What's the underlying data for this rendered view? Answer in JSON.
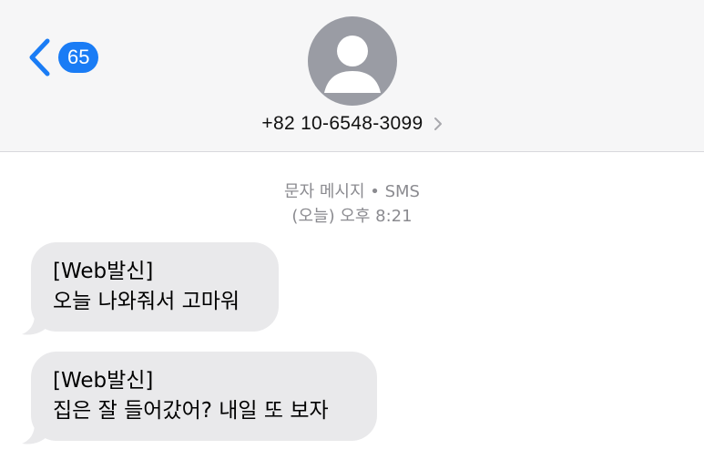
{
  "header": {
    "back_badge": "65",
    "contact_number": "+82 10-6548-3099"
  },
  "meta": {
    "channel": "문자 메시지 • SMS",
    "timestamp": "(오늘) 오후 8:21"
  },
  "messages": [
    {
      "line1": "[Web발신]",
      "line2": "오늘 나와줘서 고마워"
    },
    {
      "line1": "[Web발신]",
      "line2": "집은 잘 들어갔어? 내일 또 보자"
    }
  ],
  "colors": {
    "accent": "#1a7cf5",
    "header_bg": "#f6f6f7",
    "bubble_bg": "#e9e9eb",
    "meta_text": "#8b8b90",
    "avatar_bg": "#9a9ca4"
  },
  "icons": {
    "back": "chevron-left-icon",
    "avatar": "person-silhouette-icon",
    "contact_details": "chevron-right-icon"
  }
}
